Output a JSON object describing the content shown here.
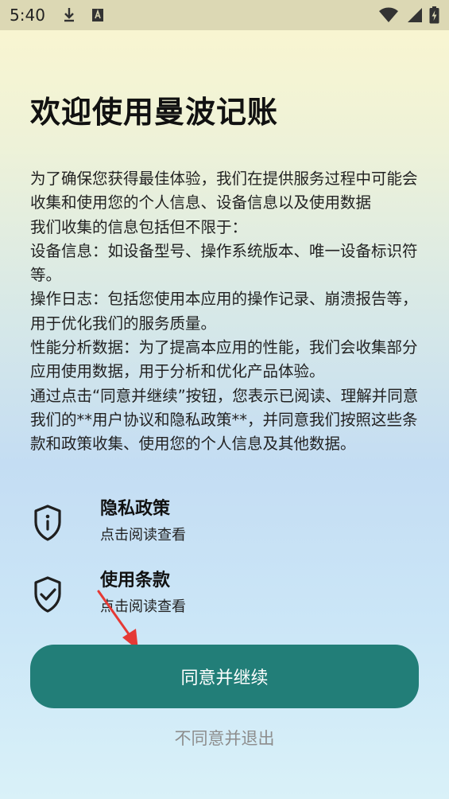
{
  "status_bar": {
    "time": "5:40",
    "left_icons": [
      "download-icon",
      "keyboard-a-icon"
    ],
    "right_icons": [
      "wifi-icon",
      "signal-icon",
      "battery-charging-icon"
    ]
  },
  "welcome": {
    "title": "欢迎使用曼波记账"
  },
  "intro": {
    "paragraphs": [
      "为了确保您获得最佳体验，我们在提供服务过程中可能会收集和使用您的个人信息、设备信息以及使用数据",
      "我们收集的信息包括但不限于：",
      "设备信息：如设备型号、操作系统版本、唯一设备标识符等。",
      "操作日志：包括您使用本应用的操作记录、崩溃报告等，用于优化我们的服务质量。",
      "性能分析数据：为了提高本应用的性能，我们会收集部分应用使用数据，用于分析和优化产品体验。",
      "通过点击“同意并继续”按钮，您表示已阅读、理解并同意我们的**用户协议和隐私政策**，并同意我们按照这些条款和政策收集、使用您的个人信息及其他数据。"
    ]
  },
  "links": {
    "privacy": {
      "icon": "shield-info-icon",
      "title": "隐私政策",
      "subtitle": "点击阅读查看"
    },
    "terms": {
      "icon": "shield-check-icon",
      "title": "使用条款",
      "subtitle": "点击阅读查看"
    }
  },
  "actions": {
    "agree_label": "同意并继续",
    "decline_label": "不同意并退出"
  },
  "colors": {
    "primary_button": "#227e78",
    "decline_text": "#8d8d8d",
    "annotation_arrow": "#e53935"
  }
}
